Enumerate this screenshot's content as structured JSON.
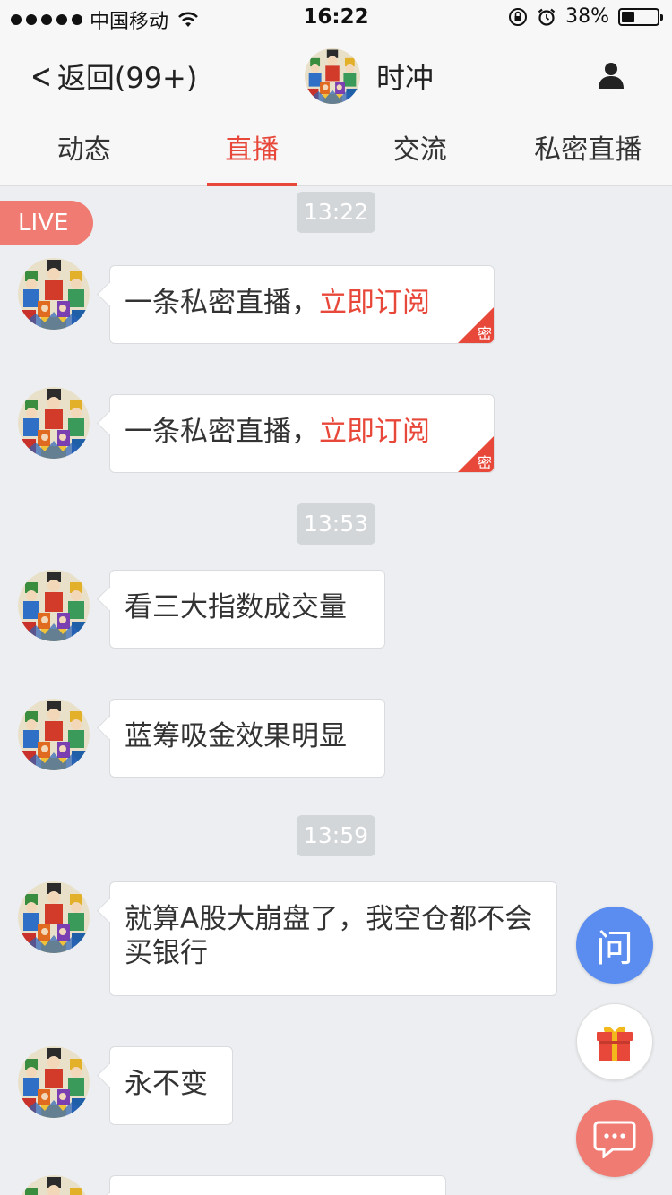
{
  "status_bar": {
    "carrier": "中国移动",
    "time": "16:22",
    "battery_percent": "38%",
    "battery_level": 0.38
  },
  "nav": {
    "back_label": "返回(99+)",
    "title": "时冲"
  },
  "tabs": [
    {
      "label": "动态",
      "active": false
    },
    {
      "label": "直播",
      "active": true
    },
    {
      "label": "交流",
      "active": false
    },
    {
      "label": "私密直播",
      "active": false
    }
  ],
  "live_badge": "LIVE",
  "timestamps": [
    "13:22",
    "13:53",
    "13:59"
  ],
  "messages": [
    {
      "text": "一条私密直播，",
      "link": "立即订阅",
      "tag": "密"
    },
    {
      "text": "一条私密直播，",
      "link": "立即订阅",
      "tag": "密"
    },
    {
      "text": "看三大指数成交量"
    },
    {
      "text": "蓝筹吸金效果明显"
    },
    {
      "text": "就算A股大崩盘了，我空仓都不会买银行"
    },
    {
      "text": "永不变"
    }
  ],
  "fabs": {
    "ask_label": "问",
    "ask_color": "#5a8def",
    "gift_icon": "gift-icon",
    "chat_icon": "chat-bubble-icon",
    "chat_color": "#f07b72"
  },
  "colors": {
    "accent": "#e8483a",
    "live": "#f07b72",
    "background": "#eceef1"
  }
}
